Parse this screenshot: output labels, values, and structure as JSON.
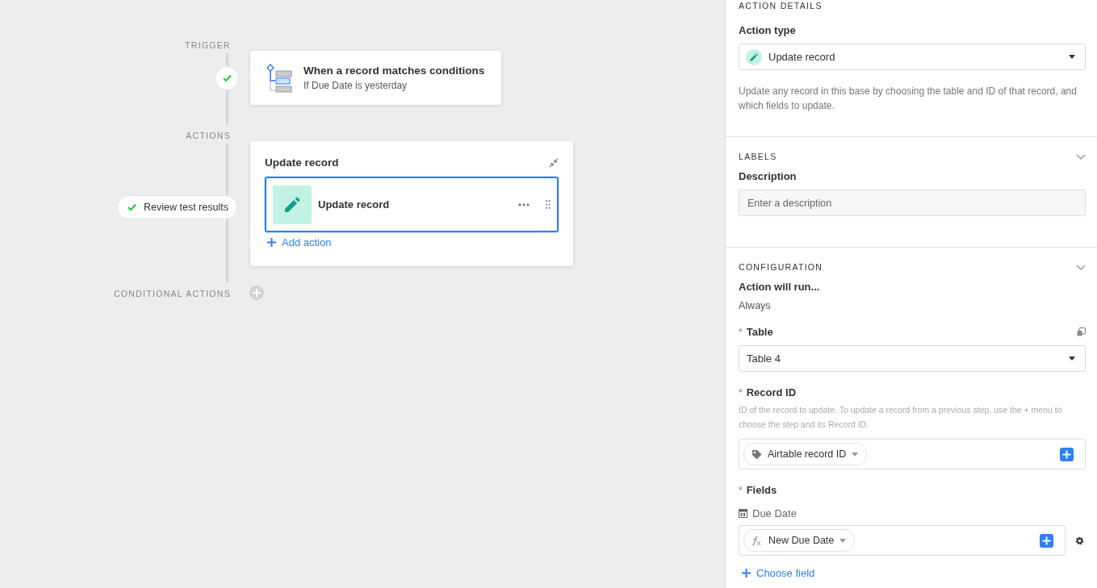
{
  "canvas": {
    "trigger_label": "TRIGGER",
    "trigger_status": {
      "passed": true
    },
    "trigger_card": {
      "title": "When a record matches conditions",
      "subtitle": "If Due Date is yesterday"
    },
    "actions_label": "ACTIONS",
    "test_button": {
      "label": "Review test results",
      "passed": true
    },
    "action_group": {
      "title": "Update record",
      "steps": [
        {
          "label": "Update record",
          "selected": true
        }
      ],
      "add_action": "Add action"
    },
    "conditional_label": "CONDITIONAL ACTIONS"
  },
  "panel": {
    "action_details": {
      "heading": "ACTION DETAILS",
      "action_type_label": "Action type",
      "action_type": "Update record",
      "description": "Update any record in this base by choosing the table and ID of that record, and which fields to update."
    },
    "labels": {
      "heading": "LABELS",
      "expanded": true,
      "description_label": "Description",
      "description_placeholder": "Enter a description"
    },
    "configuration": {
      "heading": "CONFIGURATION",
      "expanded": true,
      "run_label": "Action will run...",
      "run_value": "Always",
      "table": {
        "required_mark": "*",
        "label": "Table",
        "value": "Table 4"
      },
      "record_id": {
        "required_mark": "*",
        "label": "Record ID",
        "help": "ID of the record to update. To update a record from a previous step, use the + menu to choose the step and its Record ID.",
        "token": "Airtable record ID"
      },
      "fields": {
        "required_mark": "*",
        "label": "Fields",
        "items": [
          {
            "name": "Due Date",
            "token": "New Due Date"
          }
        ],
        "choose_field": "Choose field"
      }
    }
  }
}
